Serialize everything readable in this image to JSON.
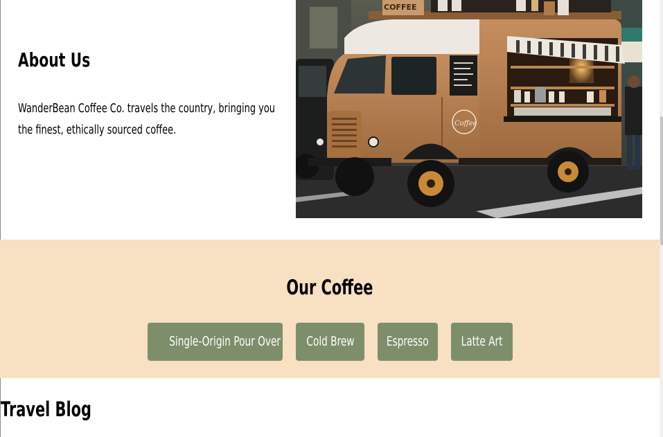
{
  "about": {
    "title": "About Us",
    "text": "WanderBean Coffee Co. travels the country, bringing you the finest, ethically sourced coffee."
  },
  "hero_image": {
    "subject": "coffee-truck",
    "truck_top_sign": "COFFEE",
    "truck_door_logo": "Coffee"
  },
  "our_coffee": {
    "title": "Our Coffee",
    "buttons": [
      {
        "label": "Single-Origin Pour Over"
      },
      {
        "label": "Cold Brew"
      },
      {
        "label": "Espresso"
      },
      {
        "label": "Latte Art"
      }
    ]
  },
  "travel_blog": {
    "title": "Travel Blog"
  },
  "colors": {
    "coffee_section_bg": "#f8e0c3",
    "button_bg": "#7d8e6b",
    "button_text": "#ffffff"
  }
}
